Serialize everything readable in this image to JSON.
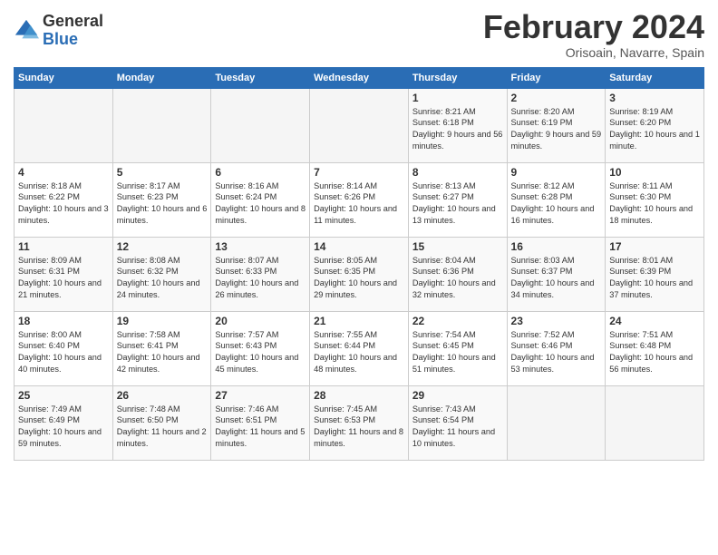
{
  "logo": {
    "general": "General",
    "blue": "Blue"
  },
  "header": {
    "month": "February 2024",
    "location": "Orisoain, Navarre, Spain"
  },
  "weekdays": [
    "Sunday",
    "Monday",
    "Tuesday",
    "Wednesday",
    "Thursday",
    "Friday",
    "Saturday"
  ],
  "weeks": [
    [
      {
        "day": "",
        "empty": true
      },
      {
        "day": "",
        "empty": true
      },
      {
        "day": "",
        "empty": true
      },
      {
        "day": "",
        "empty": true
      },
      {
        "day": "1",
        "sunrise": "8:21 AM",
        "sunset": "6:18 PM",
        "daylight": "9 hours and 56 minutes."
      },
      {
        "day": "2",
        "sunrise": "8:20 AM",
        "sunset": "6:19 PM",
        "daylight": "9 hours and 59 minutes."
      },
      {
        "day": "3",
        "sunrise": "8:19 AM",
        "sunset": "6:20 PM",
        "daylight": "10 hours and 1 minute."
      }
    ],
    [
      {
        "day": "4",
        "sunrise": "8:18 AM",
        "sunset": "6:22 PM",
        "daylight": "10 hours and 3 minutes."
      },
      {
        "day": "5",
        "sunrise": "8:17 AM",
        "sunset": "6:23 PM",
        "daylight": "10 hours and 6 minutes."
      },
      {
        "day": "6",
        "sunrise": "8:16 AM",
        "sunset": "6:24 PM",
        "daylight": "10 hours and 8 minutes."
      },
      {
        "day": "7",
        "sunrise": "8:14 AM",
        "sunset": "6:26 PM",
        "daylight": "10 hours and 11 minutes."
      },
      {
        "day": "8",
        "sunrise": "8:13 AM",
        "sunset": "6:27 PM",
        "daylight": "10 hours and 13 minutes."
      },
      {
        "day": "9",
        "sunrise": "8:12 AM",
        "sunset": "6:28 PM",
        "daylight": "10 hours and 16 minutes."
      },
      {
        "day": "10",
        "sunrise": "8:11 AM",
        "sunset": "6:30 PM",
        "daylight": "10 hours and 18 minutes."
      }
    ],
    [
      {
        "day": "11",
        "sunrise": "8:09 AM",
        "sunset": "6:31 PM",
        "daylight": "10 hours and 21 minutes."
      },
      {
        "day": "12",
        "sunrise": "8:08 AM",
        "sunset": "6:32 PM",
        "daylight": "10 hours and 24 minutes."
      },
      {
        "day": "13",
        "sunrise": "8:07 AM",
        "sunset": "6:33 PM",
        "daylight": "10 hours and 26 minutes."
      },
      {
        "day": "14",
        "sunrise": "8:05 AM",
        "sunset": "6:35 PM",
        "daylight": "10 hours and 29 minutes."
      },
      {
        "day": "15",
        "sunrise": "8:04 AM",
        "sunset": "6:36 PM",
        "daylight": "10 hours and 32 minutes."
      },
      {
        "day": "16",
        "sunrise": "8:03 AM",
        "sunset": "6:37 PM",
        "daylight": "10 hours and 34 minutes."
      },
      {
        "day": "17",
        "sunrise": "8:01 AM",
        "sunset": "6:39 PM",
        "daylight": "10 hours and 37 minutes."
      }
    ],
    [
      {
        "day": "18",
        "sunrise": "8:00 AM",
        "sunset": "6:40 PM",
        "daylight": "10 hours and 40 minutes."
      },
      {
        "day": "19",
        "sunrise": "7:58 AM",
        "sunset": "6:41 PM",
        "daylight": "10 hours and 42 minutes."
      },
      {
        "day": "20",
        "sunrise": "7:57 AM",
        "sunset": "6:43 PM",
        "daylight": "10 hours and 45 minutes."
      },
      {
        "day": "21",
        "sunrise": "7:55 AM",
        "sunset": "6:44 PM",
        "daylight": "10 hours and 48 minutes."
      },
      {
        "day": "22",
        "sunrise": "7:54 AM",
        "sunset": "6:45 PM",
        "daylight": "10 hours and 51 minutes."
      },
      {
        "day": "23",
        "sunrise": "7:52 AM",
        "sunset": "6:46 PM",
        "daylight": "10 hours and 53 minutes."
      },
      {
        "day": "24",
        "sunrise": "7:51 AM",
        "sunset": "6:48 PM",
        "daylight": "10 hours and 56 minutes."
      }
    ],
    [
      {
        "day": "25",
        "sunrise": "7:49 AM",
        "sunset": "6:49 PM",
        "daylight": "10 hours and 59 minutes."
      },
      {
        "day": "26",
        "sunrise": "7:48 AM",
        "sunset": "6:50 PM",
        "daylight": "11 hours and 2 minutes."
      },
      {
        "day": "27",
        "sunrise": "7:46 AM",
        "sunset": "6:51 PM",
        "daylight": "11 hours and 5 minutes."
      },
      {
        "day": "28",
        "sunrise": "7:45 AM",
        "sunset": "6:53 PM",
        "daylight": "11 hours and 8 minutes."
      },
      {
        "day": "29",
        "sunrise": "7:43 AM",
        "sunset": "6:54 PM",
        "daylight": "11 hours and 10 minutes."
      },
      {
        "day": "",
        "empty": true
      },
      {
        "day": "",
        "empty": true
      }
    ]
  ],
  "labels": {
    "sunrise": "Sunrise:",
    "sunset": "Sunset:",
    "daylight": "Daylight:"
  }
}
